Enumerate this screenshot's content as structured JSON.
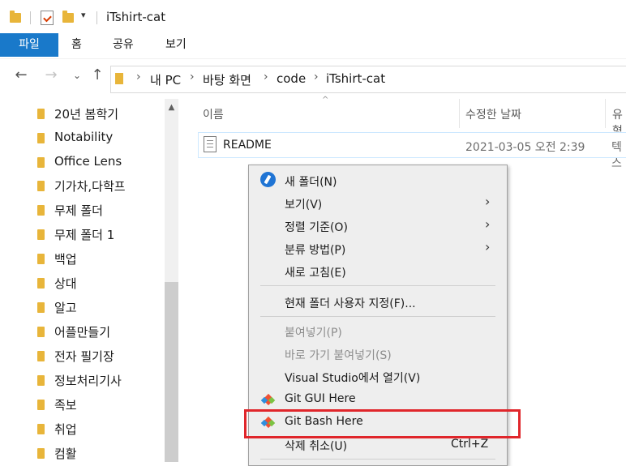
{
  "window": {
    "title": "iTshirt-cat"
  },
  "ribbon": {
    "tabs": [
      "파일",
      "홈",
      "공유",
      "보기"
    ]
  },
  "address": {
    "crumbs": [
      "내 PC",
      "바탕 화면",
      "code",
      "iTshirt-cat"
    ]
  },
  "sidebar": {
    "items": [
      "20년 봄학기",
      "Notability",
      "Office Lens",
      "기가차,다학프",
      "무제 폴더",
      "무제 폴더 1",
      "백업",
      "상대",
      "알고",
      "어플만들기",
      "전자 필기장",
      "정보처리기사",
      "족보",
      "취업",
      "컴활"
    ]
  },
  "columns": {
    "name": "이름",
    "modified": "수정한 날짜",
    "type": "유형"
  },
  "files": [
    {
      "name": "README",
      "modified": "2021-03-05 오전 2:39",
      "type": "텍스"
    }
  ],
  "context_menu": {
    "new_folder": "새 폴더(N)",
    "view": "보기(V)",
    "sort_by": "정렬 기준(O)",
    "group_by": "분류 방법(P)",
    "refresh": "새로 고침(E)",
    "customize": "현재 폴더 사용자 지정(F)...",
    "paste": "붙여넣기(P)",
    "paste_shortcut": "바로 가기 붙여넣기(S)",
    "open_vs": "Visual Studio에서 열기(V)",
    "git_gui": "Git GUI Here",
    "git_bash": "Git Bash Here",
    "undo_delete": "삭제 취소(U)",
    "undo_shortcut": "Ctrl+Z"
  },
  "colors": {
    "accent": "#1979ca",
    "highlight_box": "#e0262b",
    "git": "#f05133"
  }
}
